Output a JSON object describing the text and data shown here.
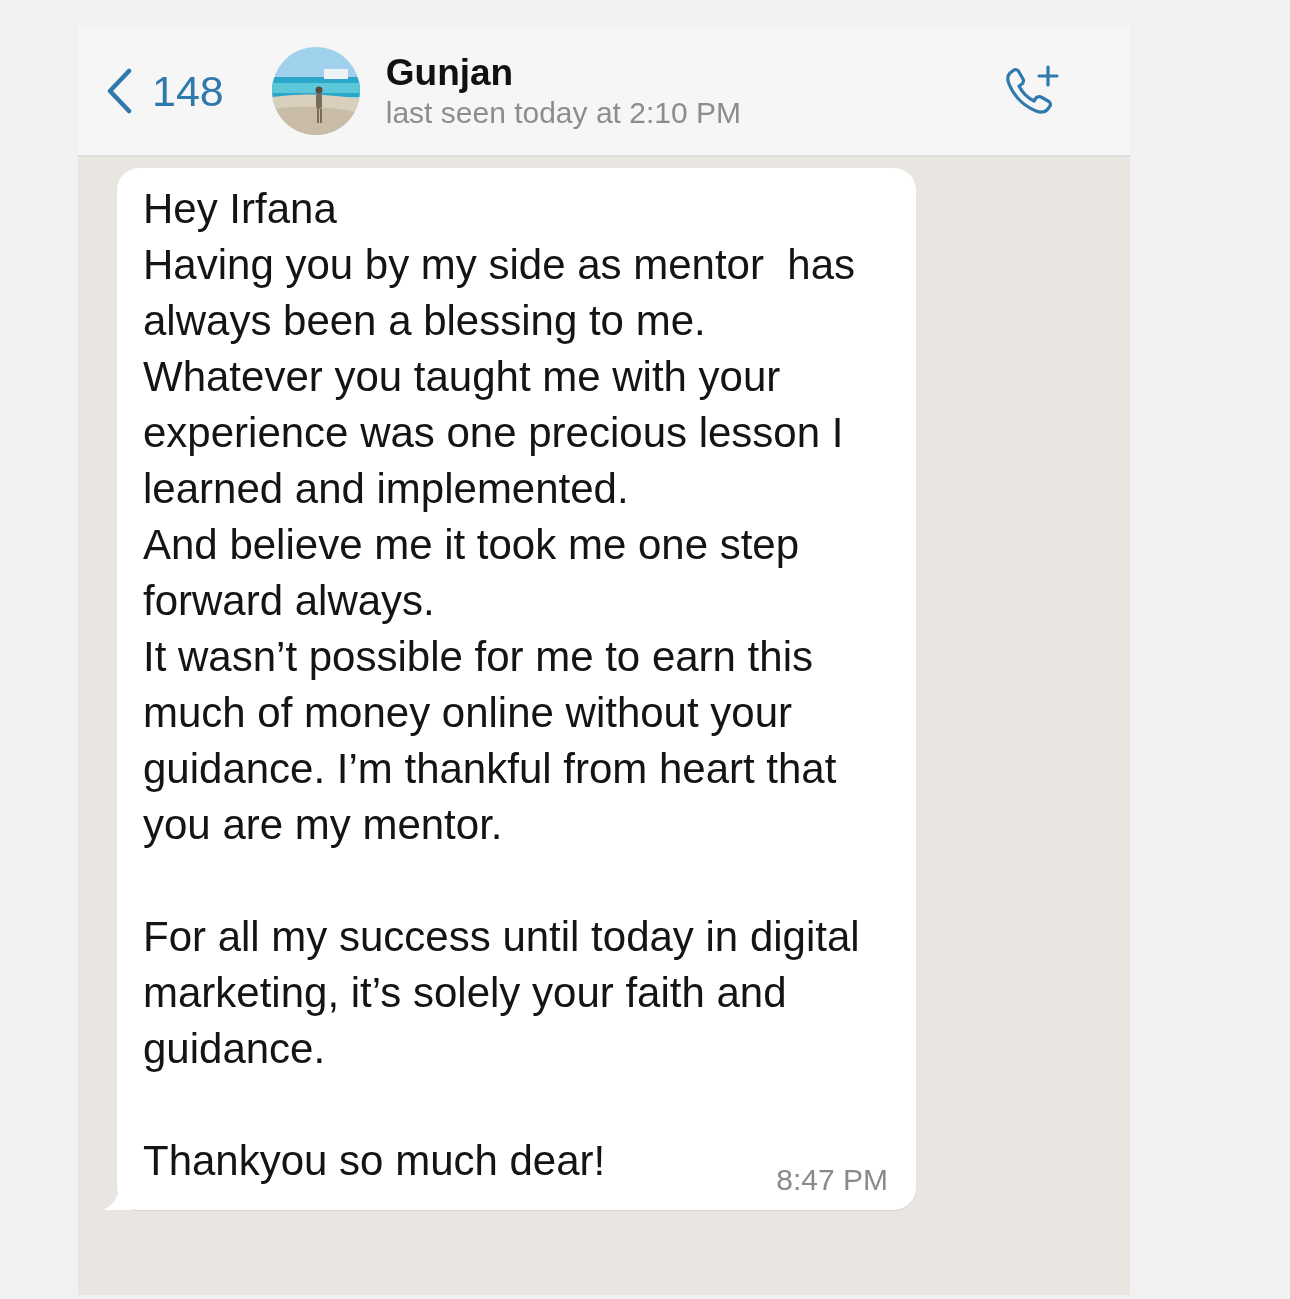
{
  "header": {
    "back_count": "148",
    "contact_name": "Gunjan",
    "status": "last seen today at 2:10 PM"
  },
  "message": {
    "blocks": [
      [
        "Hey Irfana",
        "Having you by my side as mentor  has always been a blessing to me.",
        "Whatever you taught me with your experience was one precious lesson I learned and implemented.",
        "And believe me it took me one step forward always.",
        "It wasn’t possible for me to earn this much of money online without your guidance. I’m thankful from heart that you are my mentor."
      ],
      [
        "For all my success until today in digital marketing, it’s solely your faith and guidance."
      ],
      [
        "Thankyou so much dear!"
      ]
    ],
    "time": "8:47 PM"
  }
}
